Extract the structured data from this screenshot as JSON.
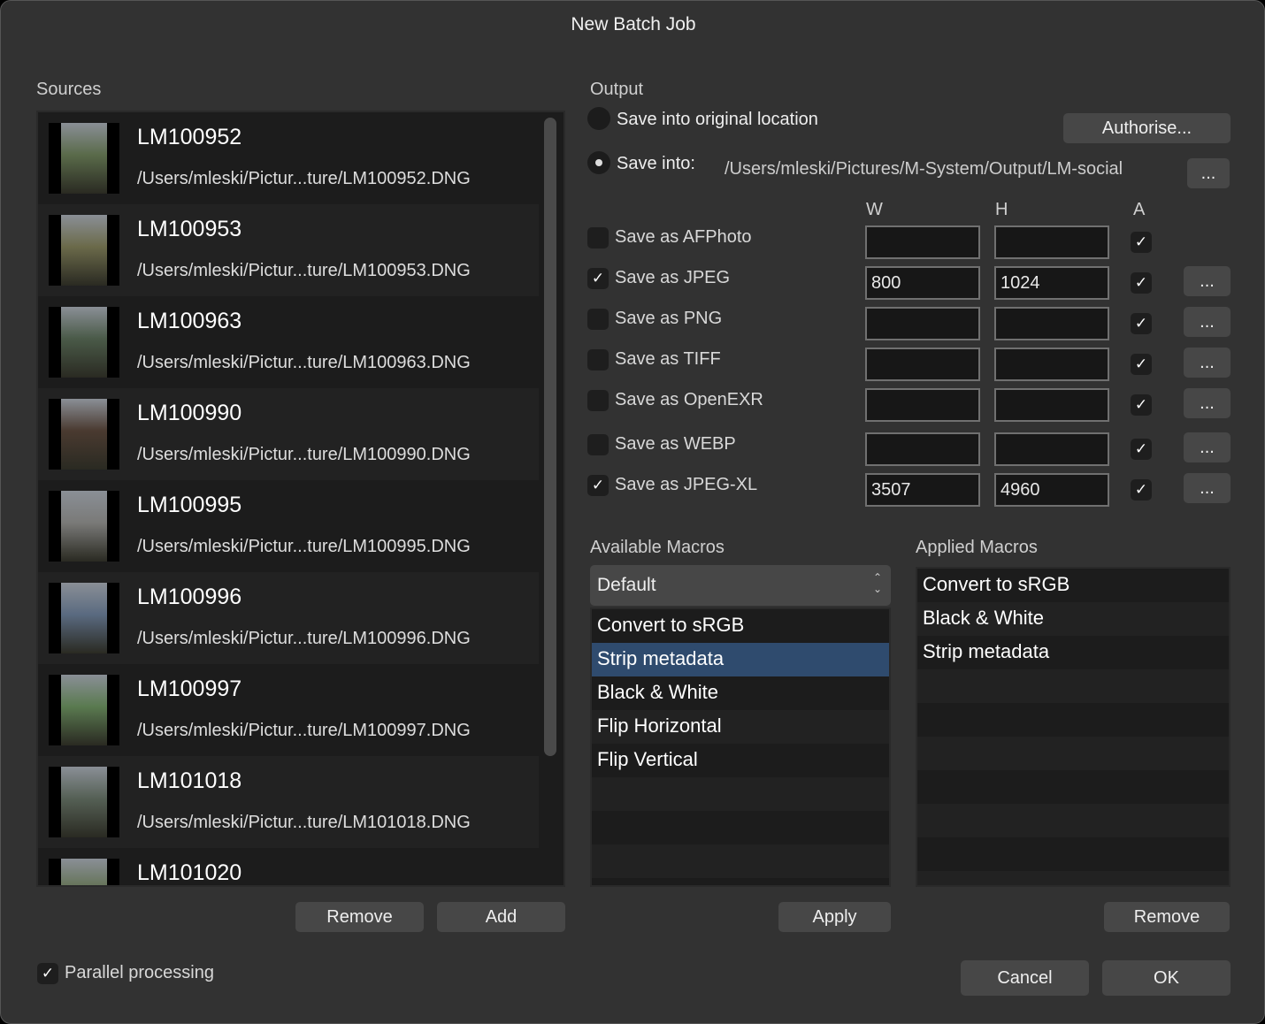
{
  "window": {
    "title": "New Batch Job"
  },
  "sources": {
    "label": "Sources",
    "items": [
      {
        "name": "LM100952",
        "path": "/Users/mleski/Pictur...ture/LM100952.DNG",
        "tint": "#5a6b4a"
      },
      {
        "name": "LM100953",
        "path": "/Users/mleski/Pictur...ture/LM100953.DNG",
        "tint": "#6b6a4a"
      },
      {
        "name": "LM100963",
        "path": "/Users/mleski/Pictur...ture/LM100963.DNG",
        "tint": "#4a5a48"
      },
      {
        "name": "LM100990",
        "path": "/Users/mleski/Pictur...ture/LM100990.DNG",
        "tint": "#4a3a30"
      },
      {
        "name": "LM100995",
        "path": "/Users/mleski/Pictur...ture/LM100995.DNG",
        "tint": "#7a7a78"
      },
      {
        "name": "LM100996",
        "path": "/Users/mleski/Pictur...ture/LM100996.DNG",
        "tint": "#5a6a80"
      },
      {
        "name": "LM100997",
        "path": "/Users/mleski/Pictur...ture/LM100997.DNG",
        "tint": "#5a7a50"
      },
      {
        "name": "LM101018",
        "path": "/Users/mleski/Pictur...ture/LM101018.DNG",
        "tint": "#556055"
      },
      {
        "name": "LM101020",
        "path": "",
        "tint": "#607050"
      }
    ],
    "remove": "Remove",
    "add": "Add"
  },
  "output": {
    "label": "Output",
    "original": "Save into original location",
    "saveinto": "Save into:",
    "path": "/Users/mleski/Pictures/M-System/Output/LM-social",
    "authorise": "Authorise...",
    "browse": "...",
    "selected": "saveinto",
    "cols": {
      "w": "W",
      "h": "H",
      "a": "A"
    },
    "formats": [
      {
        "label": "Save as AFPhoto",
        "checked": false,
        "w": "",
        "h": "",
        "a": true,
        "more": false
      },
      {
        "label": "Save as JPEG",
        "checked": true,
        "w": "800",
        "h": "1024",
        "a": true,
        "more": true
      },
      {
        "label": "Save as PNG",
        "checked": false,
        "w": "",
        "h": "",
        "a": true,
        "more": true
      },
      {
        "label": "Save as TIFF",
        "checked": false,
        "w": "",
        "h": "",
        "a": true,
        "more": true
      },
      {
        "label": "Save as OpenEXR",
        "checked": false,
        "w": "",
        "h": "",
        "a": true,
        "more": true
      },
      {
        "label": "Save as WEBP",
        "checked": false,
        "w": "",
        "h": "",
        "a": true,
        "more": true
      },
      {
        "label": "Save as JPEG-XL",
        "checked": true,
        "w": "3507",
        "h": "4960",
        "a": true,
        "more": true
      }
    ]
  },
  "available": {
    "label": "Available Macros",
    "dropdown": "Default",
    "items": [
      "Convert to sRGB",
      "Strip metadata",
      "Black & White",
      "Flip Horizontal",
      "Flip Vertical"
    ],
    "selected": 1,
    "apply": "Apply"
  },
  "applied": {
    "label": "Applied Macros",
    "items": [
      "Convert to sRGB",
      "Black & White",
      "Strip metadata"
    ],
    "remove": "Remove"
  },
  "footer": {
    "parallel": "Parallel processing",
    "parallel_checked": true,
    "cancel": "Cancel",
    "ok": "OK"
  },
  "colors": {
    "accent": "#2f4b6e",
    "background": "#323232"
  }
}
